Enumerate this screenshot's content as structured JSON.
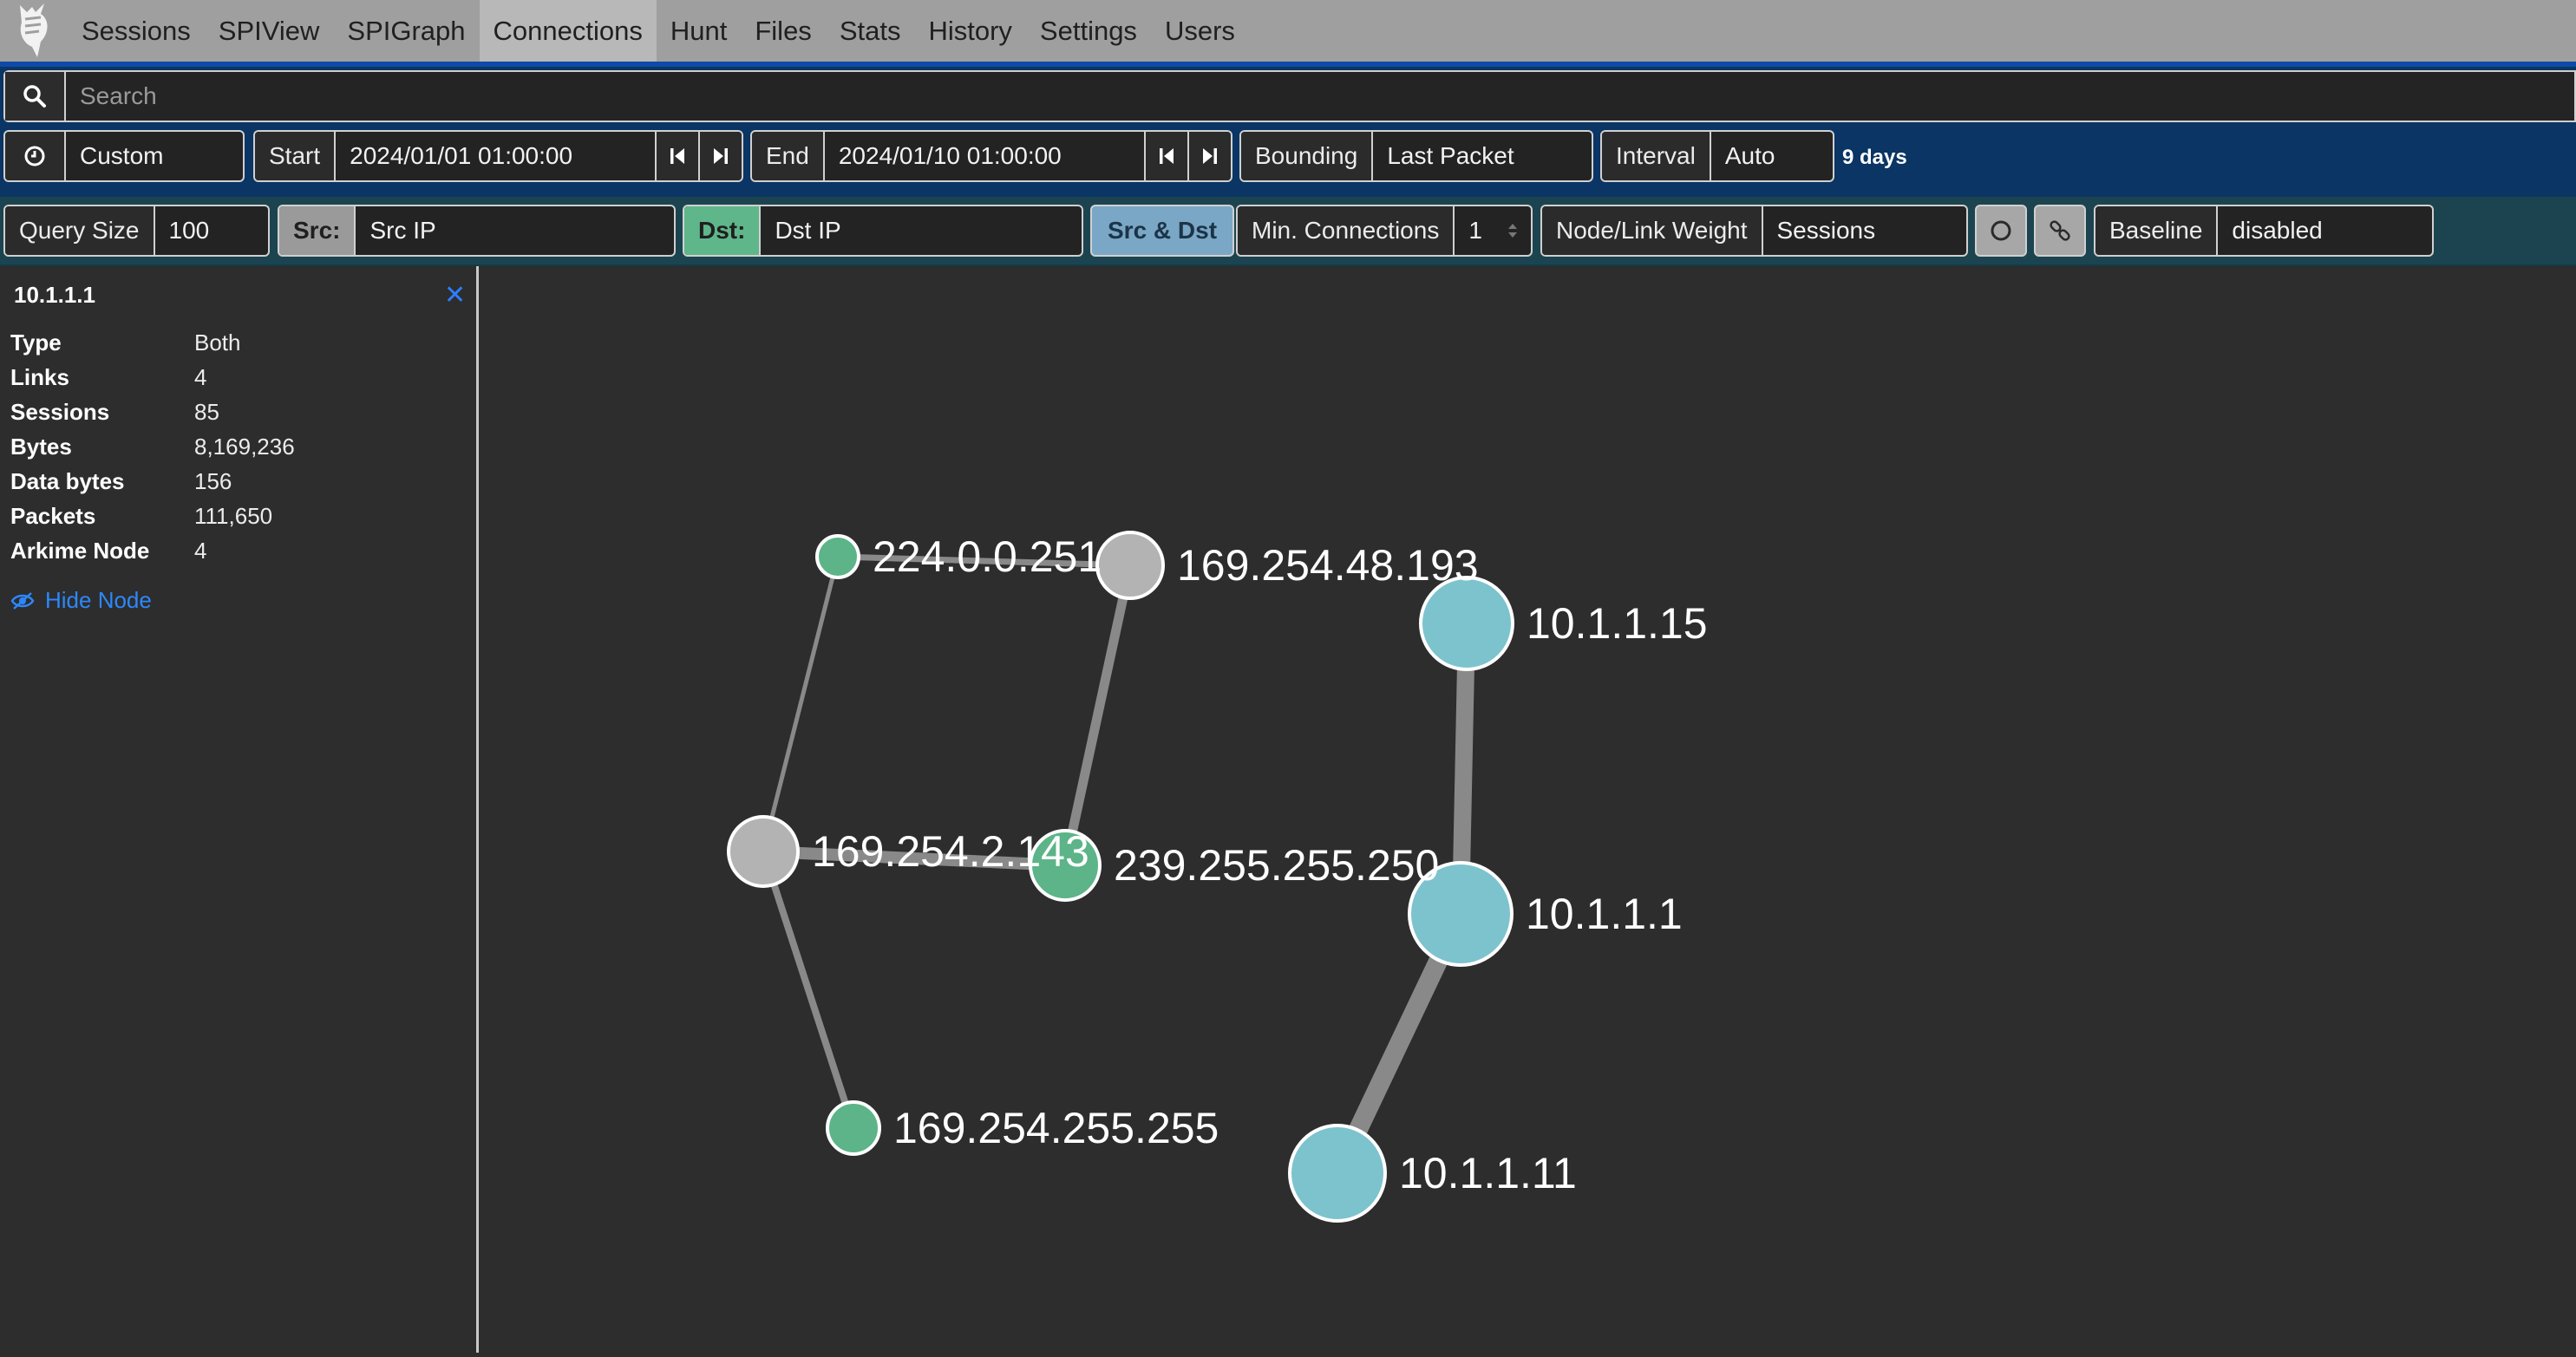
{
  "nav": {
    "items": [
      {
        "label": "Sessions"
      },
      {
        "label": "SPIView"
      },
      {
        "label": "SPIGraph"
      },
      {
        "label": "Connections",
        "active": true
      },
      {
        "label": "Hunt"
      },
      {
        "label": "Files"
      },
      {
        "label": "Stats"
      },
      {
        "label": "History"
      },
      {
        "label": "Settings"
      },
      {
        "label": "Users"
      }
    ]
  },
  "search": {
    "placeholder": "Search",
    "value": ""
  },
  "time": {
    "range_value": "Custom",
    "start_label": "Start",
    "start_value": "2024/01/01 01:00:00",
    "end_label": "End",
    "end_value": "2024/01/10 01:00:00",
    "bounding_label": "Bounding",
    "bounding_value": "Last Packet",
    "interval_label": "Interval",
    "interval_value": "Auto",
    "duration": "9 days"
  },
  "options": {
    "query_size_label": "Query Size",
    "query_size_value": "100",
    "src_label": "Src:",
    "src_value": "Src IP",
    "dst_label": "Dst:",
    "dst_value": "Dst IP",
    "srcdst_label": "Src & Dst",
    "min_conn_label": "Min. Connections",
    "min_conn_value": "1",
    "weight_label": "Node/Link Weight",
    "weight_value": "Sessions",
    "baseline_label": "Baseline",
    "baseline_value": "disabled"
  },
  "detail": {
    "title": "10.1.1.1",
    "rows": [
      {
        "k": "Type",
        "v": "Both"
      },
      {
        "k": "Links",
        "v": "4"
      },
      {
        "k": "Sessions",
        "v": "85"
      },
      {
        "k": "Bytes",
        "v": "8,169,236"
      },
      {
        "k": "Data bytes",
        "v": "156"
      },
      {
        "k": "Packets",
        "v": "111,650"
      },
      {
        "k": "Arkime Node",
        "v": "4"
      }
    ],
    "hide_label": "Hide Node"
  },
  "colors": {
    "src_node": "#b3b3b3",
    "dst_node": "#5cb488",
    "both_node": "#7dc3cd",
    "link": "#9a9a9a",
    "accent": "#0f4aa6"
  },
  "graph": {
    "nodes": [
      {
        "id": "224.0.0.251",
        "label": "224.0.0.251",
        "type": "dst"
      },
      {
        "id": "169.254.48.193",
        "label": "169.254.48.193",
        "type": "src"
      },
      {
        "id": "169.254.2.143",
        "label": "169.254.2.143",
        "type": "src"
      },
      {
        "id": "239.255.255.250",
        "label": "239.255.255.250",
        "type": "dst"
      },
      {
        "id": "169.254.255.255",
        "label": "169.254.255.255",
        "type": "dst"
      },
      {
        "id": "10.1.1.15",
        "label": "10.1.1.15",
        "type": "both"
      },
      {
        "id": "10.1.1.1",
        "label": "10.1.1.1",
        "type": "both"
      },
      {
        "id": "10.1.1.11",
        "label": "10.1.1.11",
        "type": "both"
      }
    ],
    "links": [
      {
        "source": "224.0.0.251",
        "target": "169.254.48.193"
      },
      {
        "source": "224.0.0.251",
        "target": "169.254.2.143"
      },
      {
        "source": "169.254.48.193",
        "target": "239.255.255.250"
      },
      {
        "source": "169.254.2.143",
        "target": "239.255.255.250"
      },
      {
        "source": "169.254.2.143",
        "target": "169.254.255.255"
      },
      {
        "source": "10.1.1.15",
        "target": "10.1.1.1"
      },
      {
        "source": "10.1.1.1",
        "target": "10.1.1.11"
      }
    ]
  }
}
